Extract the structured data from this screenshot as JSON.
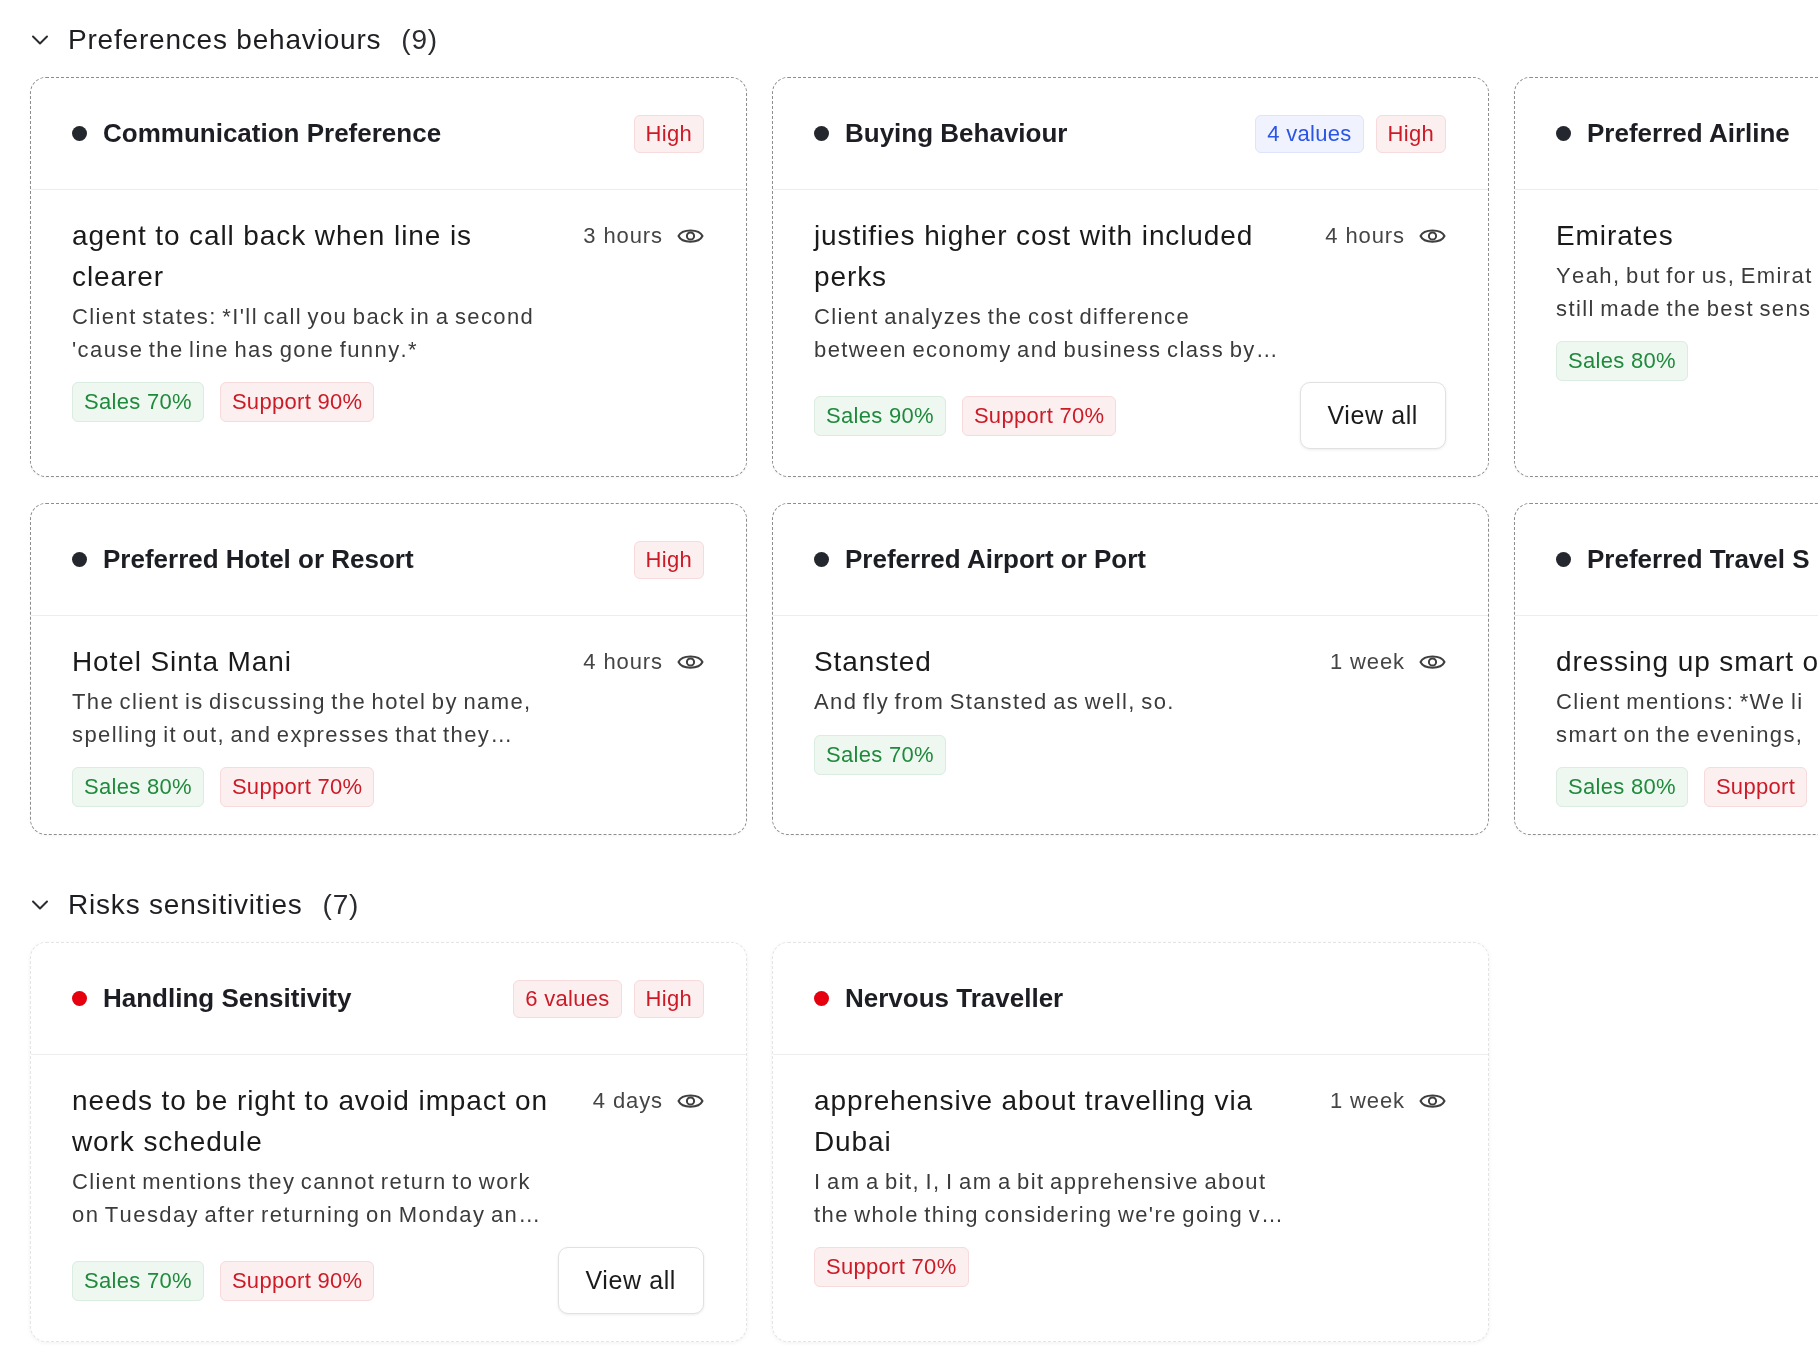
{
  "sections": [
    {
      "title": "Preferences behaviours",
      "count": "(9)",
      "expanded": true,
      "cards": [
        {
          "title": "Communication Preference",
          "color": "#24272e",
          "highlighted": true,
          "badges": [
            {
              "label": "High",
              "color": "#cc1a26"
            }
          ],
          "value": "agent to call back when line is clearer",
          "time": "3 hours",
          "description": "Client states: *I'll call you back in a second 'cause the line has gone funny.*",
          "tags": [
            {
              "label": "Sales 70%",
              "color": "#1f8a3c"
            },
            {
              "label": "Support 90%",
              "color": "#cc1a26"
            }
          ]
        },
        {
          "title": "Buying Behaviour",
          "color": "#24272e",
          "highlighted": true,
          "badges": [
            {
              "label": "4 values",
              "color": "#2a55e5"
            },
            {
              "label": "High",
              "color": "#cc1a26"
            }
          ],
          "value": "justifies higher cost with included perks",
          "time": "4 hours",
          "description": "Client analyzes the cost difference between economy and business class by…",
          "tags": [
            {
              "label": "Sales 90%",
              "color": "#1f8a3c"
            },
            {
              "label": "Support 70%",
              "color": "#cc1a26"
            }
          ],
          "action": "View all"
        },
        {
          "title": "Preferred Airline",
          "color": "#24272e",
          "highlighted": true,
          "value": "Emirates",
          "description": "Yeah, but for us, Emirat\nstill made the best sens",
          "tags": [
            {
              "label": "Sales 80%",
              "color": "#1f8a3c"
            }
          ]
        },
        {
          "title": "Preferred Hotel or Resort",
          "color": "#24272e",
          "highlighted": true,
          "badges": [
            {
              "label": "High",
              "color": "#cc1a26"
            }
          ],
          "value": "Hotel Sinta Mani",
          "time": "4 hours",
          "description": "The client is discussing the hotel by name, spelling it out, and expresses that they…",
          "tags": [
            {
              "label": "Sales 80%",
              "color": "#1f8a3c"
            },
            {
              "label": "Support 70%",
              "color": "#cc1a26"
            }
          ]
        },
        {
          "title": "Preferred Airport or Port",
          "color": "#24272e",
          "highlighted": true,
          "value": "Stansted",
          "time": "1 week",
          "description": "And fly from Stansted as well, so.",
          "tags": [
            {
              "label": "Sales 70%",
              "color": "#1f8a3c"
            }
          ]
        },
        {
          "title": "Preferred Travel S",
          "color": "#24272e",
          "highlighted": true,
          "value": "dressing up smart o",
          "description": "Client mentions: *We li\nsmart on the evenings,",
          "tags": [
            {
              "label": "Sales 80%",
              "color": "#1f8a3c"
            },
            {
              "label": "Support",
              "color": "#cc1a26"
            }
          ]
        }
      ]
    },
    {
      "title": "Risks sensitivities",
      "count": "(7)",
      "expanded": true,
      "cards": [
        {
          "title": "Handling Sensitivity",
          "color": "#e5000f",
          "highlighted": false,
          "badges": [
            {
              "label": "6 values",
              "color": "#cc1a26"
            },
            {
              "label": "High",
              "color": "#cc1a26"
            }
          ],
          "value": "needs to be right to avoid impact on work schedule",
          "time": "4 days",
          "description": "Client mentions they cannot return to work on Tuesday after returning on Monday an…",
          "tags": [
            {
              "label": "Sales 70%",
              "color": "#1f8a3c"
            },
            {
              "label": "Support 90%",
              "color": "#cc1a26"
            }
          ],
          "action": "View all"
        },
        {
          "title": "Nervous Traveller",
          "color": "#e5000f",
          "highlighted": false,
          "value": "apprehensive about travelling via Dubai",
          "time": "1 week",
          "description": "I am a bit, I, I am a bit apprehensive about the whole thing considering we're going v…",
          "tags": [
            {
              "label": "Support 70%",
              "color": "#cc1a26"
            }
          ]
        }
      ]
    }
  ]
}
